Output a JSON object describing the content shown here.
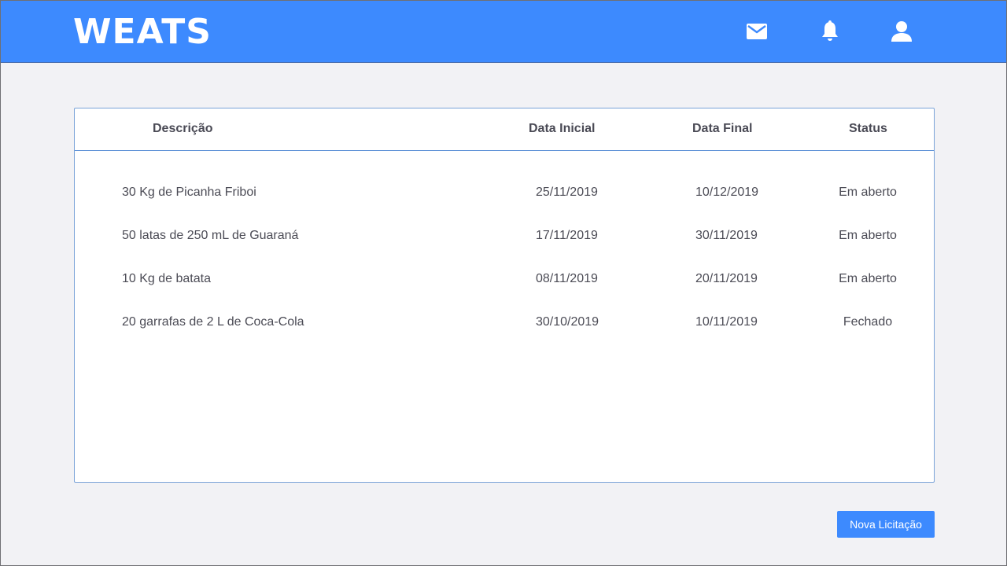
{
  "app": {
    "logo": "WEATS"
  },
  "header": {
    "icons": [
      "mail-icon",
      "bell-icon",
      "user-icon"
    ]
  },
  "table": {
    "columns": {
      "description": "Descrição",
      "start_date": "Data Inicial",
      "end_date": "Data Final",
      "status": "Status"
    },
    "rows": [
      {
        "description": "30 Kg de Picanha Friboi",
        "start_date": "25/11/2019",
        "end_date": "10/12/2019",
        "status": "Em aberto"
      },
      {
        "description": "50 latas de 250 mL de Guaraná",
        "start_date": "17/11/2019",
        "end_date": "30/11/2019",
        "status": "Em aberto"
      },
      {
        "description": "10 Kg de batata",
        "start_date": "08/11/2019",
        "end_date": "20/11/2019",
        "status": "Em aberto"
      },
      {
        "description": "20 garrafas de 2 L de Coca-Cola",
        "start_date": "30/10/2019",
        "end_date": "10/11/2019",
        "status": "Fechado"
      }
    ]
  },
  "actions": {
    "new_bid_label": "Nova Licitação"
  },
  "colors": {
    "primary": "#3d8afe",
    "background": "#f2f2f5",
    "text": "#4b4b55"
  }
}
